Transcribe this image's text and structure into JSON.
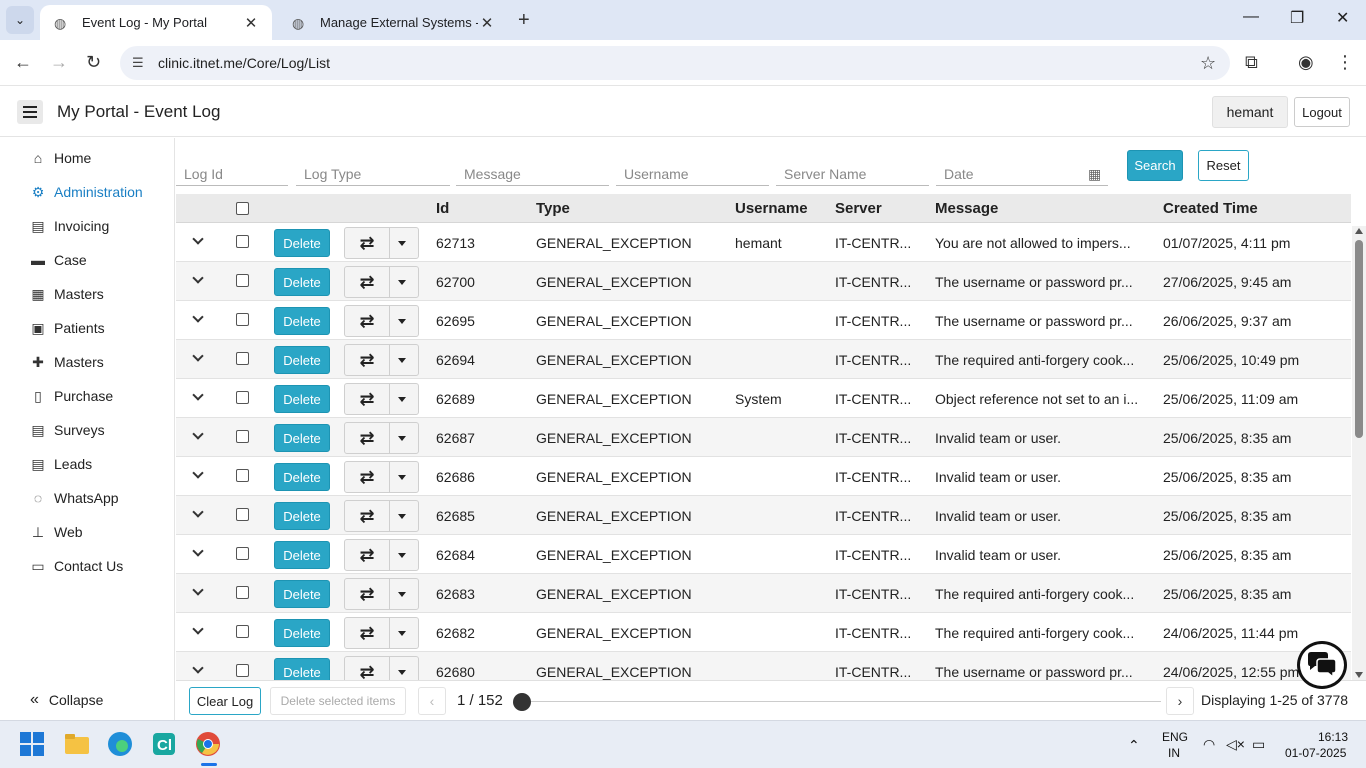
{
  "browser": {
    "tabs": [
      {
        "title": "Event Log - My Portal",
        "active": true
      },
      {
        "title": "Manage External Systems - My",
        "active": false
      }
    ],
    "url": "clinic.itnet.me/Core/Log/List"
  },
  "header": {
    "title": "My Portal  - Event Log",
    "user": "hemant",
    "logout_label": "Logout"
  },
  "sidebar": {
    "items": [
      {
        "label": "Home",
        "icon": "home-icon",
        "glyph": "⌂",
        "active": false
      },
      {
        "label": "Administration",
        "icon": "users-cog-icon",
        "glyph": "⚙",
        "active": true
      },
      {
        "label": "Invoicing",
        "icon": "invoice-icon",
        "glyph": "▤",
        "active": false
      },
      {
        "label": "Case",
        "icon": "briefcase-icon",
        "glyph": "▬",
        "active": false
      },
      {
        "label": "Masters",
        "icon": "table-icon",
        "glyph": "▦",
        "active": false
      },
      {
        "label": "Patients",
        "icon": "calendar-plus-icon",
        "glyph": "▣",
        "active": false
      },
      {
        "label": "Masters",
        "icon": "medkit-icon",
        "glyph": "✚",
        "active": false
      },
      {
        "label": "Purchase",
        "icon": "clipboard-icon",
        "glyph": "▯",
        "active": false
      },
      {
        "label": "Surveys",
        "icon": "document-icon",
        "glyph": "▤",
        "active": false
      },
      {
        "label": "Leads",
        "icon": "document-icon",
        "glyph": "▤",
        "active": false
      },
      {
        "label": "WhatsApp",
        "icon": "whatsapp-icon",
        "glyph": "◌",
        "active": false
      },
      {
        "label": "Web",
        "icon": "sitemap-icon",
        "glyph": "⊥",
        "active": false
      },
      {
        "label": "Contact Us",
        "icon": "contact-card-icon",
        "glyph": "▭",
        "active": false
      }
    ],
    "collapse_label": "Collapse"
  },
  "filters": {
    "log_id": "Log Id",
    "log_type": "Log Type",
    "message": "Message",
    "username": "Username",
    "server_name": "Server Name",
    "date": "Date",
    "search_label": "Search",
    "reset_label": "Reset"
  },
  "table": {
    "columns": {
      "id": "Id",
      "type": "Type",
      "username": "Username",
      "server": "Server",
      "message": "Message",
      "created": "Created Time"
    },
    "delete_label": "Delete",
    "rows": [
      {
        "id": "62713",
        "type": "GENERAL_EXCEPTION",
        "username": "hemant",
        "server": "IT-CENTR...",
        "message": "You are not allowed to impers...",
        "created": "01/07/2025, 4:11 pm"
      },
      {
        "id": "62700",
        "type": "GENERAL_EXCEPTION",
        "username": "",
        "server": "IT-CENTR...",
        "message": "The username or password pr...",
        "created": "27/06/2025, 9:45 am"
      },
      {
        "id": "62695",
        "type": "GENERAL_EXCEPTION",
        "username": "",
        "server": "IT-CENTR...",
        "message": "The username or password pr...",
        "created": "26/06/2025, 9:37 am"
      },
      {
        "id": "62694",
        "type": "GENERAL_EXCEPTION",
        "username": "",
        "server": "IT-CENTR...",
        "message": "The required anti-forgery cook...",
        "created": "25/06/2025, 10:49 pm"
      },
      {
        "id": "62689",
        "type": "GENERAL_EXCEPTION",
        "username": "System",
        "server": "IT-CENTR...",
        "message": "Object reference not set to an i...",
        "created": "25/06/2025, 11:09 am"
      },
      {
        "id": "62687",
        "type": "GENERAL_EXCEPTION",
        "username": "",
        "server": "IT-CENTR...",
        "message": "Invalid team or user.",
        "created": "25/06/2025, 8:35 am"
      },
      {
        "id": "62686",
        "type": "GENERAL_EXCEPTION",
        "username": "",
        "server": "IT-CENTR...",
        "message": "Invalid team or user.",
        "created": "25/06/2025, 8:35 am"
      },
      {
        "id": "62685",
        "type": "GENERAL_EXCEPTION",
        "username": "",
        "server": "IT-CENTR...",
        "message": "Invalid team or user.",
        "created": "25/06/2025, 8:35 am"
      },
      {
        "id": "62684",
        "type": "GENERAL_EXCEPTION",
        "username": "",
        "server": "IT-CENTR...",
        "message": "Invalid team or user.",
        "created": "25/06/2025, 8:35 am"
      },
      {
        "id": "62683",
        "type": "GENERAL_EXCEPTION",
        "username": "",
        "server": "IT-CENTR...",
        "message": "The required anti-forgery cook...",
        "created": "25/06/2025, 8:35 am"
      },
      {
        "id": "62682",
        "type": "GENERAL_EXCEPTION",
        "username": "",
        "server": "IT-CENTR...",
        "message": "The required anti-forgery cook...",
        "created": "24/06/2025, 11:44 pm"
      },
      {
        "id": "62680",
        "type": "GENERAL_EXCEPTION",
        "username": "",
        "server": "IT-CENTR...",
        "message": "The username or password pr...",
        "created": "24/06/2025, 12:55 pm"
      }
    ]
  },
  "footer": {
    "clear_label": "Clear Log",
    "delete_selected_label": "Delete selected items",
    "page_info": "1 / 152",
    "display_info": "Displaying 1-25 of 3778"
  },
  "taskbar": {
    "lang": "ENG",
    "region": "IN",
    "time": "16:13",
    "date": "01-07-2025"
  },
  "colors": {
    "accent": "#2aa6c6",
    "active_nav": "#1a7fc4"
  }
}
